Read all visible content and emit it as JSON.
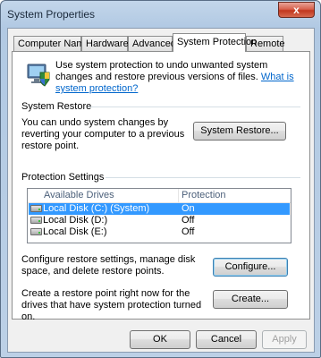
{
  "window": {
    "title": "System Properties",
    "close_symbol": "x"
  },
  "tabs": [
    {
      "label": "Computer Name"
    },
    {
      "label": "Hardware"
    },
    {
      "label": "Advanced"
    },
    {
      "label": "System Protection"
    },
    {
      "label": "Remote"
    }
  ],
  "intro": {
    "text": "Use system protection to undo unwanted system changes and restore previous versions of files.",
    "link": "What is system protection?"
  },
  "restore": {
    "group_label": "System Restore",
    "text": "You can undo system changes by reverting your computer to a previous restore point.",
    "button": "System Restore..."
  },
  "protection": {
    "group_label": "Protection Settings",
    "columns": [
      "Available Drives",
      "Protection"
    ],
    "drives": [
      {
        "name": "Local Disk (C:) (System)",
        "protection": "On",
        "selected": true
      },
      {
        "name": "Local Disk (D:)",
        "protection": "Off",
        "selected": false
      },
      {
        "name": "Local Disk (E:)",
        "protection": "Off",
        "selected": false
      }
    ],
    "configure_text": "Configure restore settings, manage disk space, and delete restore points.",
    "configure_button": "Configure...",
    "create_text": "Create a restore point right now for the drives that have system protection turned on.",
    "create_button": "Create..."
  },
  "footer": {
    "ok": "OK",
    "cancel": "Cancel",
    "apply": "Apply"
  },
  "colors": {
    "selection": "#3399ff",
    "link": "#0066cc",
    "close_button": "#c1381f"
  }
}
